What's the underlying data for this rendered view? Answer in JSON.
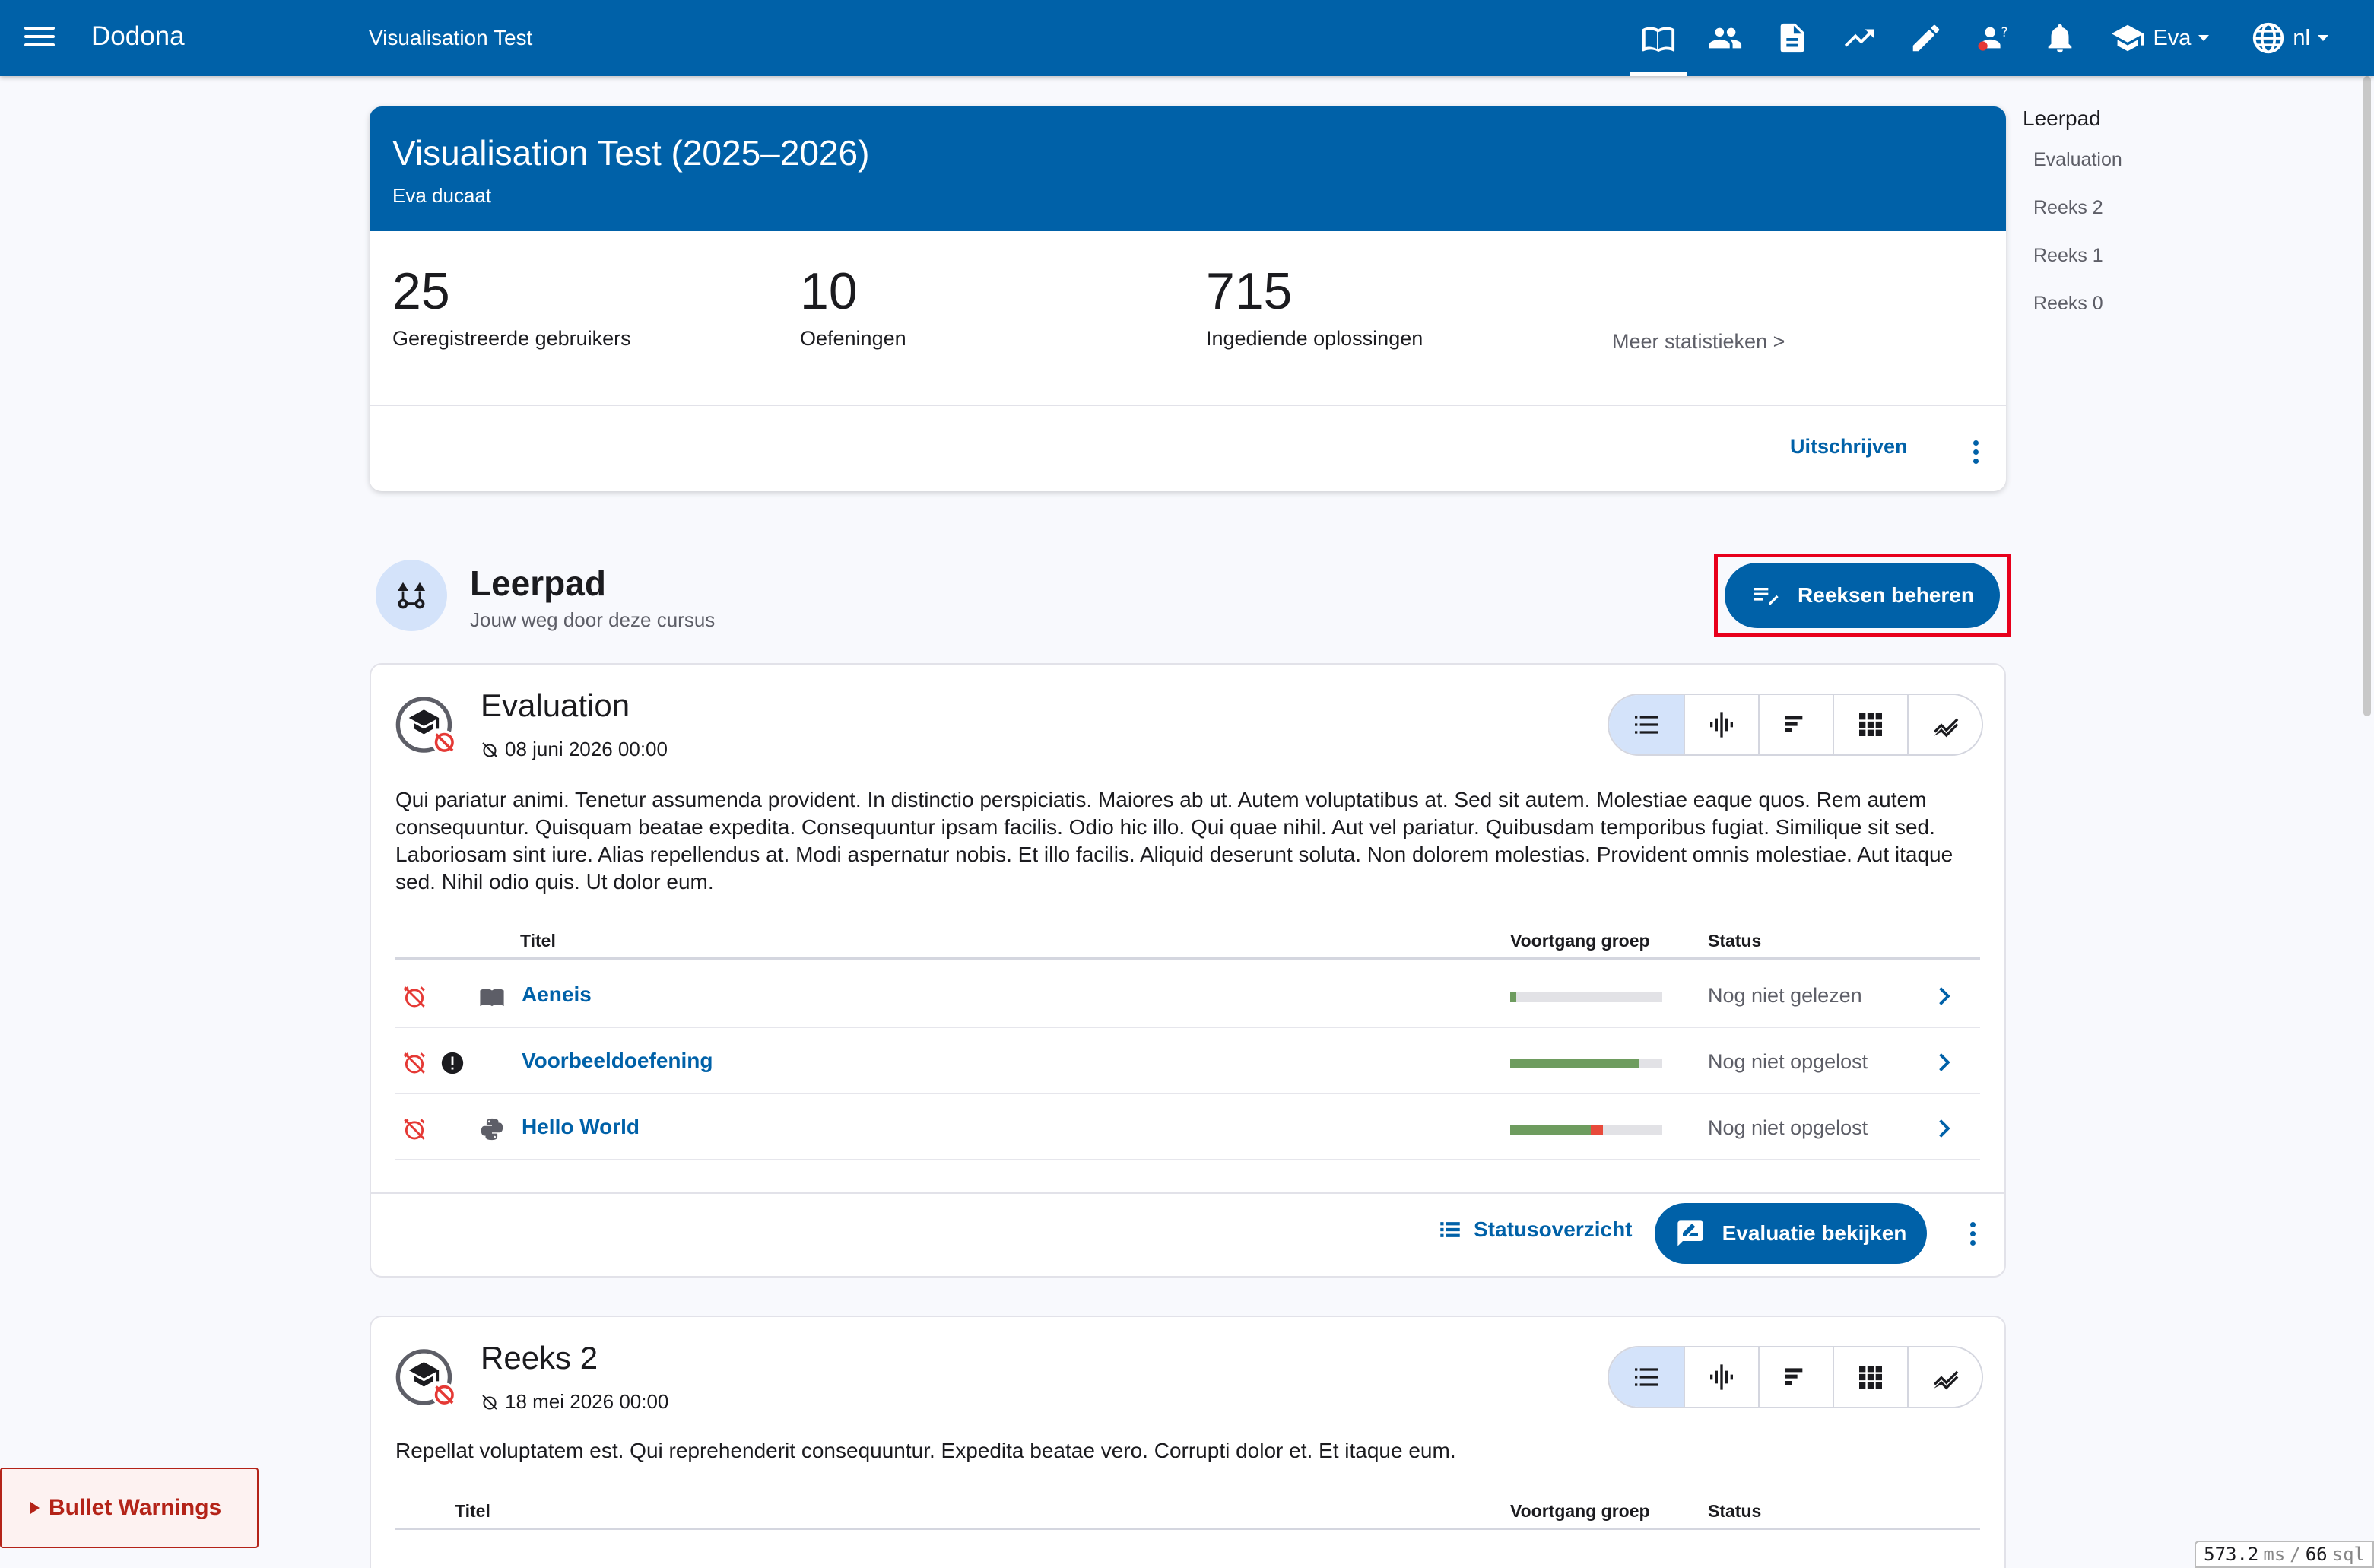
{
  "topbar": {
    "brand": "Dodona",
    "course_link": "Visualisation Test",
    "user": "Eva",
    "language": "nl",
    "icons": [
      "course-book-icon",
      "users-icon",
      "document-icon",
      "trending-up-icon",
      "pencil-icon",
      "question-users-icon",
      "bell-icon"
    ],
    "accent_color": "#0061a8"
  },
  "course": {
    "title": "Visualisation Test (2025–2026)",
    "teacher": "Eva ducaat",
    "stats": [
      {
        "value": "25",
        "label": "Geregistreerde gebruikers"
      },
      {
        "value": "10",
        "label": "Oefeningen"
      },
      {
        "value": "715",
        "label": "Ingediende oplossingen"
      }
    ],
    "more_stats": "Meer statistieken >",
    "unsubscribe": "Uitschrijven"
  },
  "toc": {
    "title": "Leerpad",
    "items": [
      "Evaluation",
      "Reeks 2",
      "Reeks 1",
      "Reeks 0"
    ]
  },
  "learning_path": {
    "title": "Leerpad",
    "subtitle": "Jouw weg door deze cursus",
    "manage_button": "Reeksen beheren"
  },
  "series": [
    {
      "title": "Evaluation",
      "deadline": "08 juni 2026 00:00",
      "description": "Qui pariatur animi. Tenetur assumenda provident. In distinctio perspiciatis. Maiores ab ut. Autem voluptatibus at. Sed sit autem. Molestiae eaque quos. Rem autem consequuntur. Quisquam beatae expedita. Consequuntur ipsam facilis. Odio hic illo. Qui quae nihil. Aut vel pariatur. Quibusdam temporibus fugiat. Similique sit sed. Laboriosam sint iure. Alias repellendus at. Modi aspernatur nobis. Et illo facilis. Aliquid deserunt soluta. Non dolorem molestias. Provident omnis molestiae. Aut itaque sed. Nihil odio quis. Ut dolor eum.",
      "columns": {
        "title": "Titel",
        "progress": "Voortgang groep",
        "status": "Status"
      },
      "exercises": [
        {
          "name": "Aeneis",
          "type_icon": "book-icon",
          "status": "Nog niet gelezen",
          "progress_correct": 0.04,
          "progress_wrong": 0
        },
        {
          "name": "Voorbeeldoefening",
          "type_icon": "alert-circle-icon",
          "status": "Nog niet opgelost",
          "progress_correct": 0.85,
          "progress_wrong": 0
        },
        {
          "name": "Hello World",
          "type_icon": "python-icon",
          "status": "Nog niet opgelost",
          "progress_correct": 0.53,
          "progress_wrong": 0.08
        }
      ],
      "status_overview": "Statusoverzicht",
      "evaluation_button": "Evaluatie bekijken"
    },
    {
      "title": "Reeks 2",
      "deadline": "18 mei 2026 00:00",
      "description": "Repellat voluptatem est. Qui reprehenderit consequuntur. Expedita beatae vero. Corrupti dolor et. Et itaque eum.",
      "columns": {
        "title": "Titel",
        "progress": "Voortgang groep",
        "status": "Status"
      }
    }
  ],
  "bullet": {
    "label": "Bullet Warnings"
  },
  "perf": {
    "ms": "573.2",
    "ms_unit": "ms",
    "sep": "/",
    "sql": "66",
    "sql_unit": "sql"
  },
  "colors": {
    "correct": "#6e9c5f",
    "wrong": "#e84a3b",
    "alarm": "#e53935"
  }
}
